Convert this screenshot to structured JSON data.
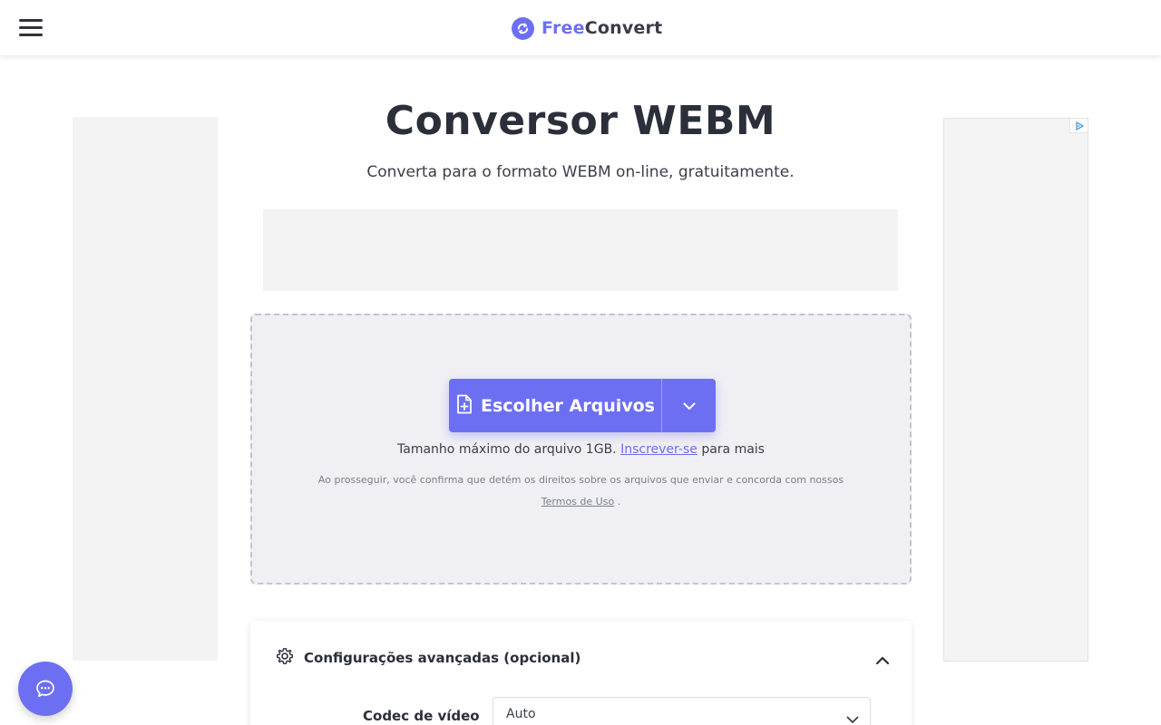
{
  "header": {
    "logo_free": "Free",
    "logo_convert": "Convert",
    "menu_icon": "hamburger-menu-icon"
  },
  "hero": {
    "title": "Conversor WEBM",
    "subtitle": "Converta para o formato WEBM on-line, gratuitamente."
  },
  "upload": {
    "choose_label": "Escolher Arquivos",
    "max_size_text": "Tamanho máximo do arquivo 1GB.",
    "signup_link": "Inscrever-se",
    "max_size_suffix": "para mais",
    "consent_text": "Ao prosseguir, você confirma que detém os direitos sobre os arquivos que enviar e concorda com nossos",
    "terms_link": "Termos de Uso",
    "terms_suffix": "."
  },
  "advanced": {
    "title": "Configurações avançadas (opcional)",
    "codec_label": "Codec de vídeo",
    "codec_value": "Auto"
  },
  "colors": {
    "accent": "#6d6ff2",
    "dropzone_bg": "#efeff4",
    "text_dark": "#2b2f3a"
  },
  "icons": {
    "logo": "convert-arrows-icon",
    "file_add": "file-plus-icon",
    "dropdown": "chevron-down-icon",
    "settings": "gear-icon",
    "collapse": "chevron-up-icon",
    "chat": "chat-bubble-icon",
    "adchoices": "adchoices-icon"
  }
}
